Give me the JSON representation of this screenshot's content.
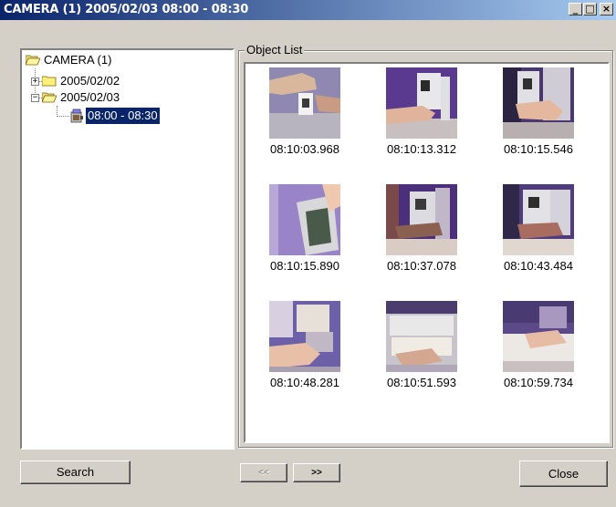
{
  "window": {
    "title": "CAMERA (1)  2005/02/03 08:00 - 08:30"
  },
  "caption_buttons": {
    "minimize": "_",
    "maximize": "□",
    "close": "×"
  },
  "tree": {
    "root": "CAMERA (1)",
    "nodes": [
      {
        "label": "2005/02/02",
        "expander": "+"
      },
      {
        "label": "2005/02/03",
        "expander": "−"
      }
    ],
    "selected_child": "08:00 - 08:30"
  },
  "object_list": {
    "label": "Object List",
    "items": [
      {
        "time": "08:10:03.968"
      },
      {
        "time": "08:10:13.312"
      },
      {
        "time": "08:10:15.546"
      },
      {
        "time": "08:10:15.890"
      },
      {
        "time": "08:10:37.078"
      },
      {
        "time": "08:10:43.484"
      },
      {
        "time": "08:10:48.281"
      },
      {
        "time": "08:10:51.593"
      },
      {
        "time": "08:10:59.734"
      }
    ]
  },
  "buttons": {
    "search": "Search",
    "prev": "<<",
    "next": ">>",
    "close": "Close"
  }
}
